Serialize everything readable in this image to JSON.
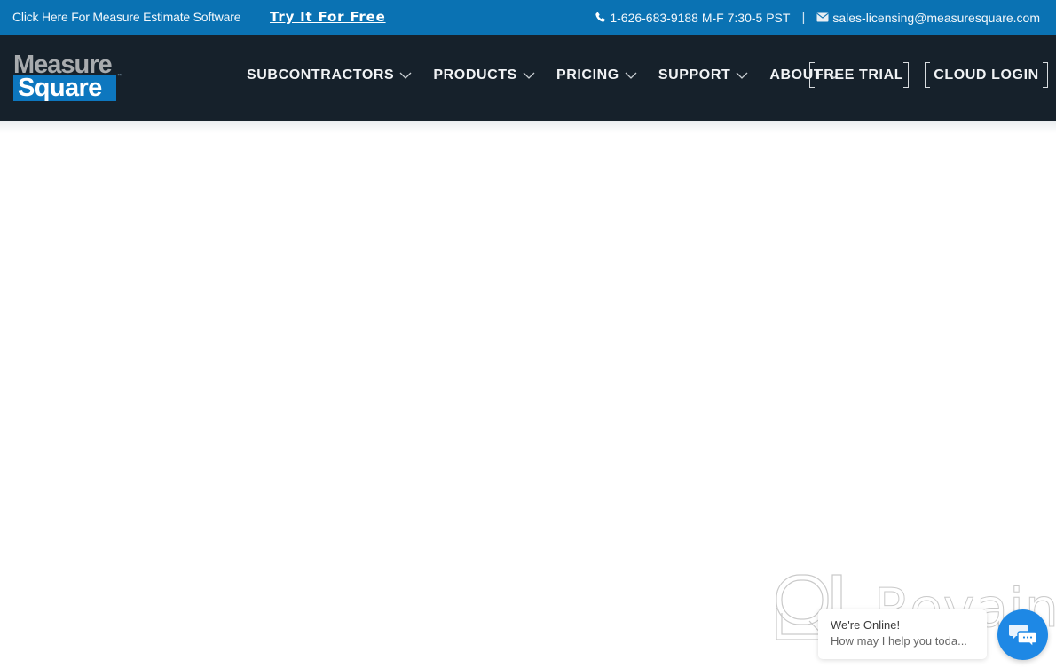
{
  "topbar": {
    "promo_text": "Click Here For Measure Estimate Software",
    "cta_link": "Try It For Free",
    "phone_icon": "phone-icon",
    "phone": "1-626-683-9188 M-F 7:30-5 PST",
    "separator": "|",
    "email_icon": "envelope-icon",
    "email": "sales-licensing@measuresquare.com",
    "colors": {
      "background": "#0a72b3"
    }
  },
  "navbar": {
    "logo": {
      "line1": "Measure",
      "line2": "Square",
      "tm": "™"
    },
    "menu": [
      {
        "label": "SUBCONTRACTORS",
        "icon": "chevron-down-icon"
      },
      {
        "label": "PRODUCTS",
        "icon": "chevron-down-icon"
      },
      {
        "label": "PRICING",
        "icon": "chevron-down-icon"
      },
      {
        "label": "SUPPORT",
        "icon": "chevron-down-icon"
      },
      {
        "label": "ABOUT",
        "icon": "chevron-down-icon"
      }
    ],
    "free_trial_label": "FREE TRIAL",
    "cloud_login_label": "CLOUD LOGIN",
    "colors": {
      "background": "#16212b"
    }
  },
  "chat": {
    "status": "We're Online!",
    "prompt": "How may I help you toda...",
    "button_icon": "chat-bubbles-icon",
    "colors": {
      "button": "#1e88e5"
    }
  },
  "watermark": {
    "text": "Revain"
  }
}
